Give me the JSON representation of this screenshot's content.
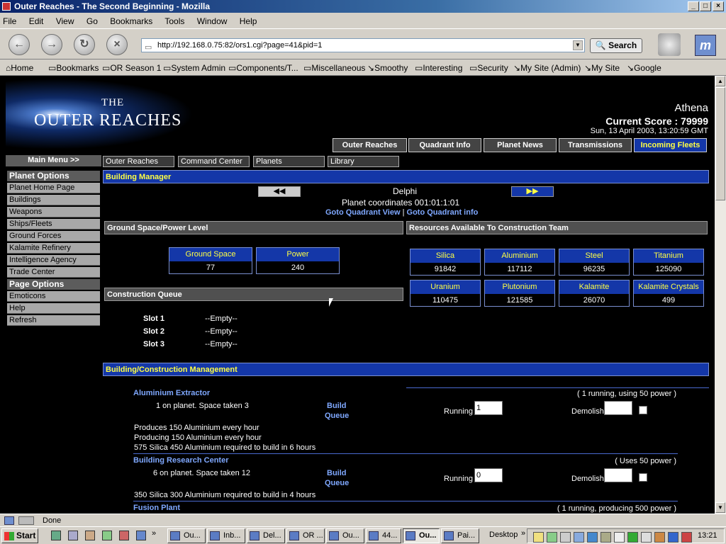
{
  "window": {
    "title": "Outer Reaches - The Second Beginning - Mozilla"
  },
  "menubar": [
    "File",
    "Edit",
    "View",
    "Go",
    "Bookmarks",
    "Tools",
    "Window",
    "Help"
  ],
  "navbar": {
    "url": "http://192.168.0.75:82/ors1.cgi?page=41&pid=1",
    "search_label": "Search"
  },
  "bookmarks": [
    "Home",
    "Bookmarks",
    "OR Season 1",
    "System Admin",
    "Components/T...",
    "Miscellaneous",
    "Smoothy",
    "Interesting",
    "Security",
    "My Site (Admin)",
    "My Site",
    "Google"
  ],
  "header": {
    "logo_the": "THE",
    "logo_name": "OUTER REACHES",
    "player": "Athena",
    "score": "Current Score : 79999",
    "date": "Sun, 13 April 2003, 13:20:59 GMT"
  },
  "top_tabs": [
    "Outer Reaches",
    "Quadrant Info",
    "Planet News",
    "Transmissions",
    "Incoming Fleets"
  ],
  "main_menu_label": "Main Menu >>",
  "sub_tabs": [
    "Outer Reaches",
    "Command Center",
    "Planets",
    "Library"
  ],
  "sidebar": {
    "planet_header": "Planet Options",
    "planet_items": [
      "Planet Home Page",
      "Buildings",
      "Weapons",
      "Ships/Fleets",
      "Ground Forces",
      "Kalamite Refinery",
      "Intelligence Agency",
      "Trade Center"
    ],
    "page_header": "Page Options",
    "page_items": [
      "Emoticons",
      "Help",
      "Refresh"
    ]
  },
  "building_manager": {
    "title": "Building Manager",
    "prev_label": "◀◀",
    "next_label": "▶▶",
    "planet": "Delphi",
    "coords": "Planet coordinates 001:01:1:01",
    "goto_view": "Goto Quadrant View",
    "separator": "|",
    "goto_info": "Goto Quadrant info"
  },
  "ground_space": {
    "title": "Ground Space/Power Level",
    "space_label": "Ground Space",
    "space_value": "77",
    "power_label": "Power",
    "power_value": "240"
  },
  "resources": {
    "title": "Resources Available To Construction Team",
    "items": [
      {
        "name": "Silica",
        "value": "91842"
      },
      {
        "name": "Aluminium",
        "value": "117112"
      },
      {
        "name": "Steel",
        "value": "96235"
      },
      {
        "name": "Titanium",
        "value": "125090"
      },
      {
        "name": "Uranium",
        "value": "110475"
      },
      {
        "name": "Plutonium",
        "value": "121585"
      },
      {
        "name": "Kalamite",
        "value": "26070"
      },
      {
        "name": "Kalamite Crystals",
        "value": "499"
      }
    ]
  },
  "queue": {
    "title": "Construction Queue",
    "slots": [
      {
        "label": "Slot 1",
        "value": "--Empty--"
      },
      {
        "label": "Slot 2",
        "value": "--Empty--"
      },
      {
        "label": "Slot 3",
        "value": "--Empty--"
      }
    ]
  },
  "management": {
    "title": "Building/Construction Management",
    "build_label": "Build",
    "queue_label": "Queue",
    "running_label": "Running",
    "demolish_label": "Demolish",
    "buildings": [
      {
        "name": "Aluminium Extractor",
        "status": "( 1 running, using 50 power )",
        "info": "1 on planet. Space taken 3",
        "running": "1",
        "lines": [
          "Produces 150 Aluminium every hour",
          "Producing 150 Aluminium every hour",
          "575 Silica 450 Aluminium required to build in 6 hours"
        ]
      },
      {
        "name": "Building Research Center",
        "status": "( Uses 50 power )",
        "info": "6 on planet. Space taken 12",
        "running": "0",
        "lines": [
          "350 Silica 300 Aluminium required to build in 4 hours"
        ]
      },
      {
        "name": "Fusion Plant",
        "status": "( 1 running, producing 500 power )"
      }
    ]
  },
  "statusbar": {
    "text": "Done"
  },
  "taskbar": {
    "start": "Start",
    "tasks": [
      "Ou...",
      "Inb...",
      "Del...",
      "OR ...",
      "Ou...",
      "44...",
      "Ou...",
      "Pai..."
    ],
    "desktop": "Desktop",
    "clock": "13:21"
  }
}
